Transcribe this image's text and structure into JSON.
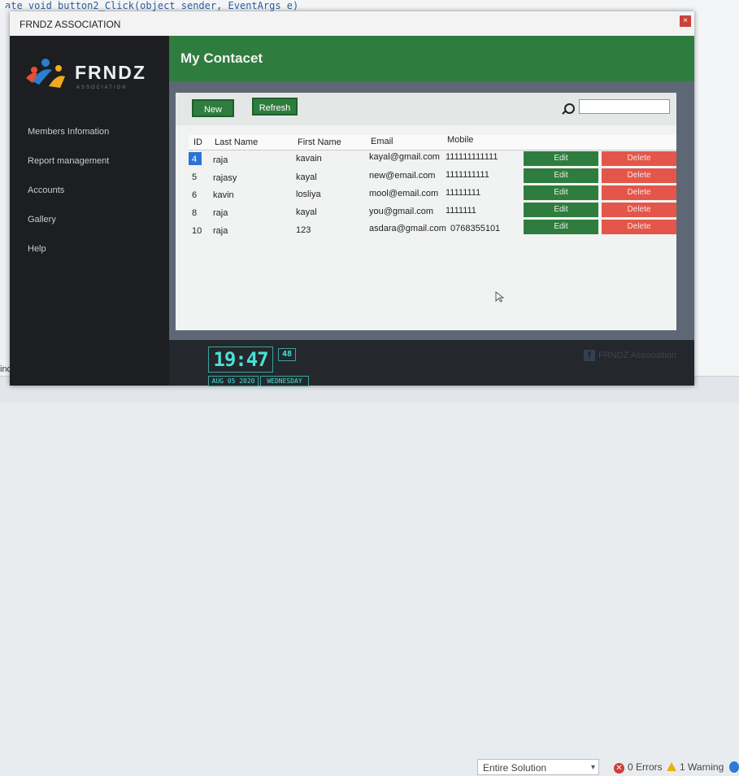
{
  "background": {
    "code_line": "ate void button2_Click(object sender, EventArgs e)",
    "left_text": "ind",
    "solution_dropdown": "Entire Solution",
    "errors": "0 Errors",
    "warnings": "1 Warning"
  },
  "window": {
    "title": "FRNDZ ASSOCIATION",
    "close": "×"
  },
  "logo": {
    "text": "FRNDZ",
    "subtitle": "ASSOCIATION"
  },
  "sidebar": {
    "items": [
      {
        "label": "Members Infomation"
      },
      {
        "label": "Report management"
      },
      {
        "label": "Accounts"
      },
      {
        "label": "Gallery"
      },
      {
        "label": "Help"
      }
    ]
  },
  "header": {
    "title": "My Contacet"
  },
  "toolbar": {
    "new_label": "New",
    "refresh_label": "Refresh",
    "search_value": ""
  },
  "table": {
    "columns": [
      "ID",
      "Last Name",
      "First Name",
      "Email",
      "Mobile"
    ],
    "edit_label": "Edit",
    "delete_label": "Delete",
    "rows": [
      {
        "id": "4",
        "last": "raja",
        "first": "kavain",
        "email": "kayal@gmail.com",
        "mobile": "111111111111"
      },
      {
        "id": "5",
        "last": "rajasy",
        "first": "kayal",
        "email": "new@email.com",
        "mobile": "1111111111"
      },
      {
        "id": "6",
        "last": "kavin",
        "first": "losliya",
        "email": "mool@email.com",
        "mobile": "11111111"
      },
      {
        "id": "8",
        "last": "raja",
        "first": "kayal",
        "email": "you@gmail.com",
        "mobile": "1111111"
      },
      {
        "id": "10",
        "last": "raja",
        "first": "123",
        "email": "asdara@gmail.com",
        "mobile": "0768355101"
      }
    ]
  },
  "clock": {
    "time": "19:47",
    "seconds": "48",
    "date": "AUG 05 2020",
    "day": "WEDNESDAY"
  },
  "footer": {
    "facebook_text": "FRNDZ Association"
  },
  "colors": {
    "accent_green": "#2f7d3e",
    "delete_red": "#e4564a",
    "clock_cyan": "#49e0d6"
  }
}
